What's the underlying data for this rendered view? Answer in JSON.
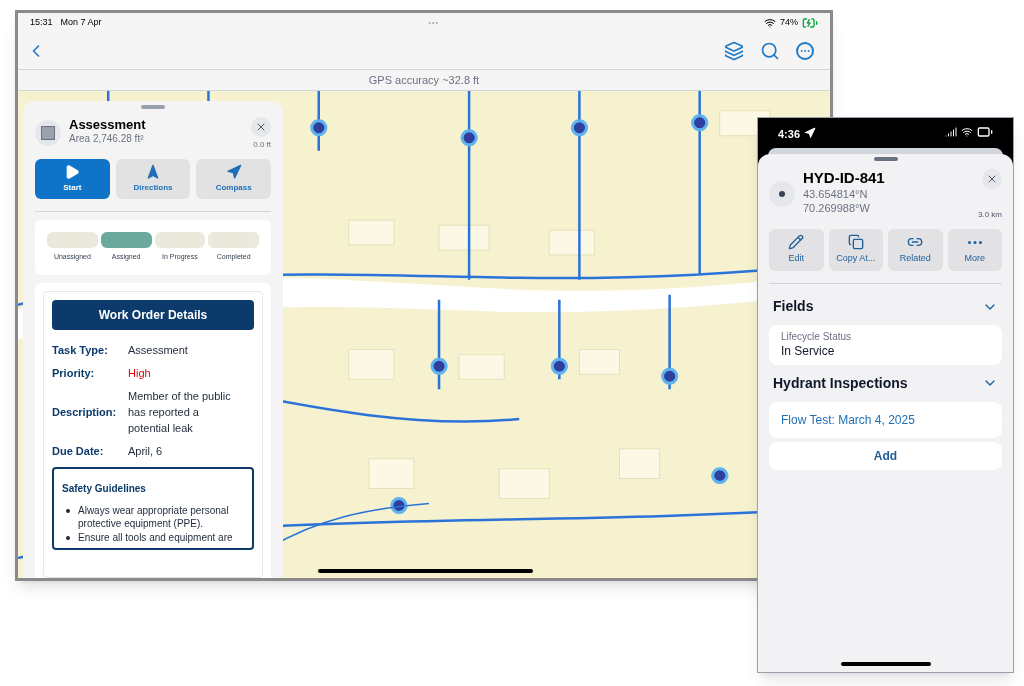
{
  "tablet": {
    "status_bar": {
      "time": "15:31",
      "date": "Mon 7 Apr",
      "battery": "74%"
    },
    "gps": "GPS accuracy ~32.8 ft",
    "feature": {
      "title": "Assessment",
      "subtitle": "Area 2,746.28 ft²",
      "distance": "0.0 ft"
    },
    "actions": [
      {
        "label": "Start",
        "kind": "start",
        "selected": true
      },
      {
        "label": "Directions",
        "kind": "directions",
        "selected": false
      },
      {
        "label": "Compass",
        "kind": "compass",
        "selected": false
      }
    ],
    "status_steps": [
      {
        "label": "Unassigned",
        "selected": false
      },
      {
        "label": "Assigned",
        "selected": true
      },
      {
        "label": "In Progress",
        "selected": false
      },
      {
        "label": "Completed",
        "selected": false
      }
    ],
    "work_order": {
      "title": "Work Order Details",
      "details": [
        {
          "label": "Task Type:",
          "value": "Assessment",
          "kind": "normal"
        },
        {
          "label": "Priority:",
          "value": "High",
          "kind": "alert"
        },
        {
          "label": "Description:",
          "value": "Member of the public has reported a potential leak",
          "kind": "normal"
        },
        {
          "label": "Due Date:",
          "value": "April, 6",
          "kind": "normal"
        }
      ],
      "safety": {
        "title": "Safety Guidelines",
        "items": [
          "Always wear appropriate personal protective equipment (PPE).",
          "Ensure all tools and equipment are"
        ]
      }
    }
  },
  "phone": {
    "time": "4:36",
    "title": "HYD-ID-841",
    "latitude": "43.654814°N",
    "longitude": "70.269988°W",
    "distance": "3.0 km",
    "actions": [
      {
        "label": "Edit",
        "kind": "edit"
      },
      {
        "label": "Copy At...",
        "kind": "copy"
      },
      {
        "label": "Related",
        "kind": "related"
      },
      {
        "label": "More",
        "kind": "more"
      }
    ],
    "sections": [
      {
        "title": "Fields",
        "expanded": true,
        "items": [
          {
            "kind": "field",
            "label": "Lifecycle Status",
            "value": "In Service"
          }
        ]
      },
      {
        "title": "Hydrant Inspections",
        "expanded": true,
        "items": [
          {
            "kind": "link",
            "value": "Flow Test: March 4, 2025"
          },
          {
            "kind": "button",
            "value": "Add"
          }
        ]
      }
    ]
  }
}
